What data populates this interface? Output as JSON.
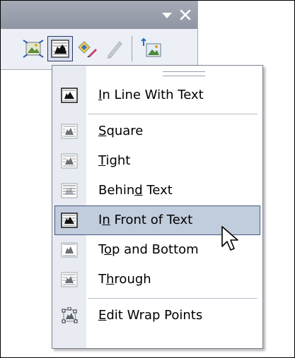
{
  "toolbar": {
    "titlebar_color": "#9aa0ae",
    "dropdown_icon": "triangle-down-icon",
    "close_icon": "close-x-icon",
    "buttons": [
      {
        "name": "reset-picture",
        "icon": "reset-picture-icon"
      },
      {
        "name": "text-wrapping",
        "icon": "wrap-in-front-icon",
        "pressed": true
      },
      {
        "name": "format-picture",
        "icon": "format-picture-icon"
      },
      {
        "name": "set-transparent-color",
        "icon": "transparent-color-pen-icon",
        "disabled": true
      },
      {
        "name": "picture-properties",
        "icon": "picture-properties-icon"
      }
    ]
  },
  "menu": {
    "highlight_color": "#c1ccdd",
    "items": [
      {
        "label": "In Line With Text",
        "hotkey": "I",
        "icon": "inline-with-text-icon"
      },
      {
        "label": "Square",
        "hotkey": "S",
        "icon": "wrap-square-icon"
      },
      {
        "label": "Tight",
        "hotkey": "T",
        "icon": "wrap-tight-icon"
      },
      {
        "label": "Behind Text",
        "hotkey": "d",
        "icon": "behind-text-icon"
      },
      {
        "label": "In Front of Text",
        "hotkey": "n",
        "icon": "in-front-of-text-icon",
        "highlighted": true
      },
      {
        "label": "Top and Bottom",
        "hotkey": "o",
        "icon": "top-and-bottom-icon"
      },
      {
        "label": "Through",
        "hotkey": "h",
        "icon": "wrap-through-icon"
      },
      {
        "label": "Edit Wrap Points",
        "hotkey": "E",
        "icon": "edit-wrap-points-icon"
      }
    ]
  }
}
